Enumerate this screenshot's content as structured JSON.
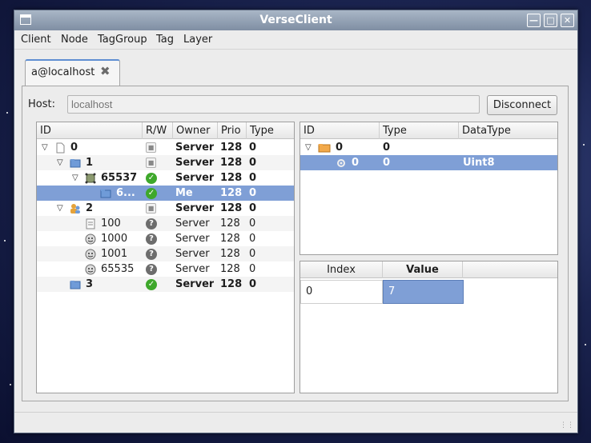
{
  "window": {
    "title": "VerseClient"
  },
  "menu": [
    "Client",
    "Node",
    "TagGroup",
    "Tag",
    "Layer"
  ],
  "tab": {
    "label": "a@localhost"
  },
  "host": {
    "label": "Host:",
    "placeholder": "localhost",
    "value": ""
  },
  "connection": {
    "button_label": "Disconnect"
  },
  "node_tree": {
    "columns": [
      "ID",
      "R/W",
      "Owner",
      "Prio",
      "Type"
    ],
    "rows": [
      {
        "id": "0",
        "depth": 0,
        "expanded": true,
        "icon": "blank-node-icon",
        "rw": "lock-icon",
        "owner": "Server",
        "prio": "128",
        "type": "0",
        "bold": true,
        "selected": false
      },
      {
        "id": "1",
        "depth": 1,
        "expanded": true,
        "icon": "folder-node-icon",
        "rw": "lock-icon",
        "owner": "Server",
        "prio": "128",
        "type": "0",
        "bold": true,
        "selected": false
      },
      {
        "id": "65537",
        "depth": 2,
        "expanded": true,
        "icon": "object-node-icon",
        "rw": "check-icon",
        "owner": "Server",
        "prio": "128",
        "type": "0",
        "bold": true,
        "selected": false
      },
      {
        "id": "6...",
        "depth": 3,
        "expanded": false,
        "icon": "folder-node-icon",
        "rw": "check-icon",
        "owner": "Me",
        "prio": "128",
        "type": "0",
        "bold": true,
        "selected": true
      },
      {
        "id": "2",
        "depth": 1,
        "expanded": true,
        "icon": "users-node-icon",
        "rw": "lock-icon",
        "owner": "Server",
        "prio": "128",
        "type": "0",
        "bold": true,
        "selected": false
      },
      {
        "id": "100",
        "depth": 2,
        "expanded": false,
        "icon": "document-node-icon",
        "rw": "question-icon",
        "owner": "Server",
        "prio": "128",
        "type": "0",
        "bold": false,
        "selected": false
      },
      {
        "id": "1000",
        "depth": 2,
        "expanded": false,
        "icon": "avatar-node-icon",
        "rw": "question-icon",
        "owner": "Server",
        "prio": "128",
        "type": "0",
        "bold": false,
        "selected": false
      },
      {
        "id": "1001",
        "depth": 2,
        "expanded": false,
        "icon": "avatar-node-icon",
        "rw": "question-icon",
        "owner": "Server",
        "prio": "128",
        "type": "0",
        "bold": false,
        "selected": false
      },
      {
        "id": "65535",
        "depth": 2,
        "expanded": false,
        "icon": "avatar-node-icon",
        "rw": "question-icon",
        "owner": "Server",
        "prio": "128",
        "type": "0",
        "bold": false,
        "selected": false
      },
      {
        "id": "3",
        "depth": 1,
        "expanded": false,
        "icon": "folder-node-icon",
        "rw": "check-icon",
        "owner": "Server",
        "prio": "128",
        "type": "0",
        "bold": true,
        "selected": false
      }
    ]
  },
  "tag_tree": {
    "columns": [
      "ID",
      "Type",
      "DataType"
    ],
    "rows": [
      {
        "id": "0",
        "type": "0",
        "datatype": "",
        "icon": "folder-tag-icon",
        "expanded": true,
        "selected": false
      },
      {
        "id": "0",
        "type": "0",
        "datatype": "Uint8",
        "icon": "gear-tag-icon",
        "expanded": false,
        "selected": true
      }
    ]
  },
  "value_table": {
    "columns": [
      "Index",
      "Value"
    ],
    "rows": [
      {
        "index": "0",
        "value": "7"
      }
    ]
  }
}
